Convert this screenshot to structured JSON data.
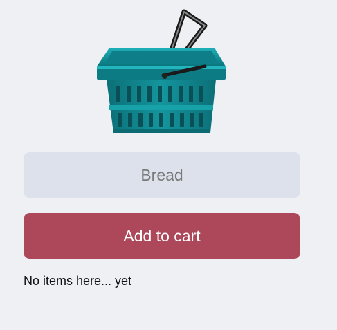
{
  "logo": {
    "icon": "shopping-basket-icon"
  },
  "input": {
    "placeholder": "Bread",
    "value": ""
  },
  "add_button": {
    "label": "Add to cart"
  },
  "cart": {
    "empty_message": "No items here... yet"
  },
  "colors": {
    "background": "#eff0f4",
    "input_background": "#dce1eb",
    "button_background": "#ac485a",
    "basket_teal": "#0f8a93"
  }
}
